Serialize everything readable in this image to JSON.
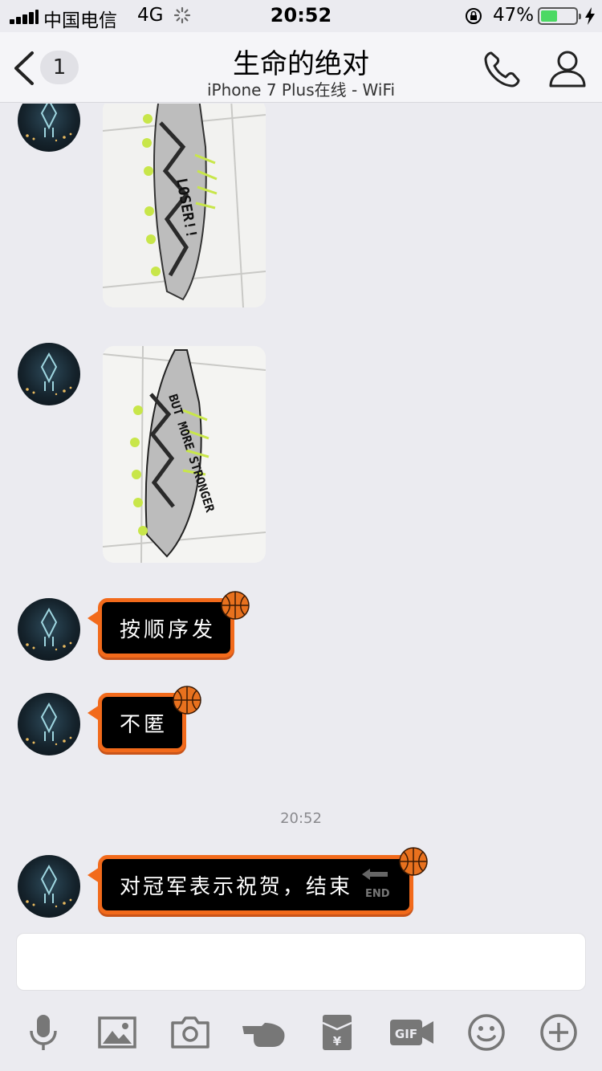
{
  "status_bar": {
    "carrier": "中国电信",
    "network": "4G",
    "time": "20:52",
    "battery_percent_label": "47%",
    "battery_level": 0.47
  },
  "nav": {
    "back_badge": "1",
    "title": "生命的绝对",
    "subtitle": "iPhone 7 Plus在线 - WiFi"
  },
  "messages": [
    {
      "type": "image",
      "shoe_text": "LOSER!!"
    },
    {
      "type": "image",
      "shoe_text": "BUT MORE STRONGER"
    },
    {
      "type": "text",
      "text": "按顺序发"
    },
    {
      "type": "text",
      "text": "不匿"
    },
    {
      "type": "text",
      "text": "对冠军表示祝贺，结束",
      "badge": "END"
    }
  ],
  "timestamp": "20:52",
  "input": {
    "value": "",
    "placeholder": ""
  },
  "toolbar": [
    "microphone-icon",
    "image-icon",
    "camera-icon",
    "hand-icon",
    "red-packet-icon",
    "gif-icon",
    "emoji-icon",
    "plus-icon"
  ],
  "colors": {
    "bubble_border": "#f26a1b",
    "bubble_fill": "#000000",
    "battery": "#4cd964",
    "background": "#ebebf0"
  }
}
